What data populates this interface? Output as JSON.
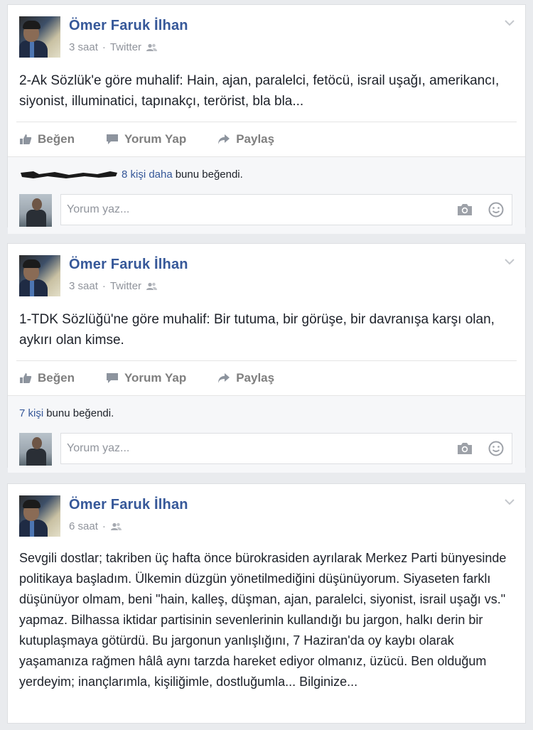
{
  "colors": {
    "page_bg": "#e9ebee",
    "card_bg": "#ffffff",
    "link": "#365899",
    "meta": "#90949c",
    "action": "#7f7f7f"
  },
  "posts": [
    {
      "author": "Ömer Faruk İlhan",
      "time": "3 saat",
      "source": "Twitter",
      "text": "2-Ak Sözlük'e göre muhalif: Hain, ajan, paralelci, fetöcü, israil uşağı, amerikancı, siyonist, illuminatici, tapınakçı, terörist, bla bla...",
      "actions": {
        "like": "Beğen",
        "comment": "Yorum Yap",
        "share": "Paylaş"
      },
      "likes": {
        "count_link": "8 kişi daha",
        "rest": "bunu beğendi."
      },
      "comment_placeholder": "Yorum yaz..."
    },
    {
      "author": "Ömer Faruk İlhan",
      "time": "3 saat",
      "source": "Twitter",
      "text": "1-TDK Sözlüğü'ne göre muhalif: Bir tutuma, bir görüşe, bir davranışa karşı olan, aykırı olan kimse.",
      "actions": {
        "like": "Beğen",
        "comment": "Yorum Yap",
        "share": "Paylaş"
      },
      "likes": {
        "count_link": "7 kişi",
        "rest": "bunu beğendi."
      },
      "comment_placeholder": "Yorum yaz..."
    },
    {
      "author": "Ömer Faruk İlhan",
      "time": "6 saat",
      "text": "Sevgili dostlar; takriben üç hafta önce bürokrasiden ayrılarak Merkez Parti bünyesinde politikaya başladım. Ülkemin düzgün yönetilmediğini düşünüyorum. Siyaseten farklı düşünüyor olmam, beni \"hain, kalleş, düşman, ajan, paralelci, siyonist, israil uşağı vs.\" yapmaz. Bilhassa iktidar partisinin sevenlerinin kullandığı bu jargon, halkı derin bir kutuplaşmaya götürdü. Bu jargonun yanlışlığını, 7 Haziran'da oy kaybı olarak yaşamanıza rağmen hâlâ aynı tarzda hareket ediyor olmanız, üzücü. Ben olduğum yerdeyim; inançlarımla, kişiliğimle, dostluğumla... Bilginize..."
    }
  ]
}
